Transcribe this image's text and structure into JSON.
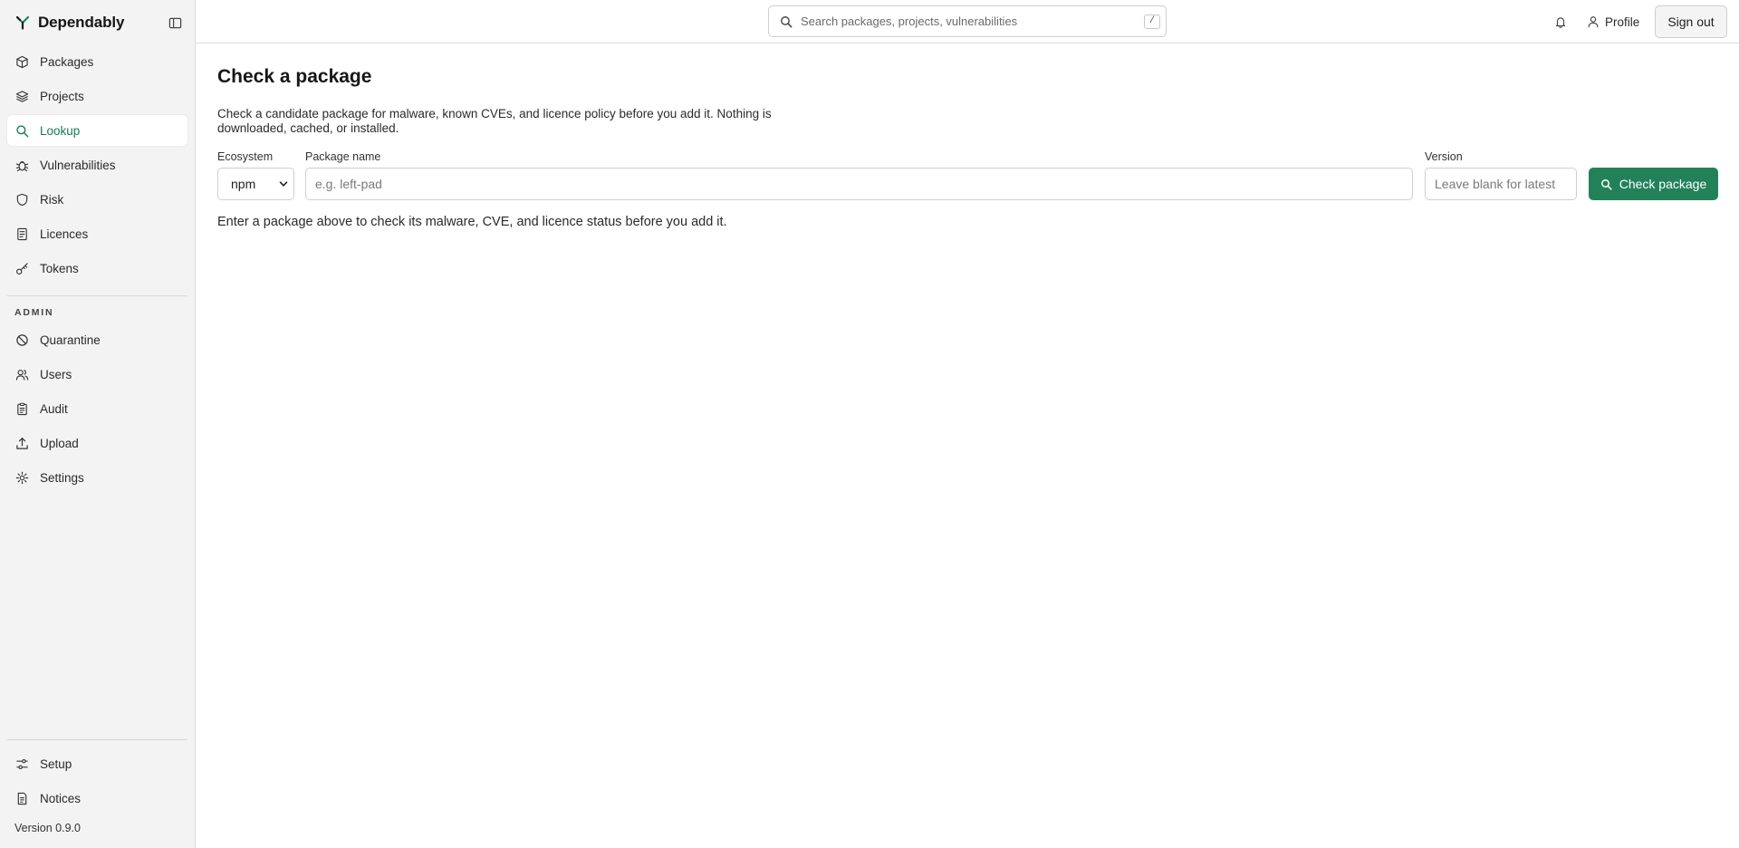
{
  "app": {
    "name": "Dependably",
    "version": "Version 0.9.0"
  },
  "colors": {
    "accent": "#23815a",
    "active_nav_text": "#1b7a52"
  },
  "sidebar": {
    "main_items": [
      {
        "label": "Packages",
        "icon": "package-icon",
        "active": false
      },
      {
        "label": "Projects",
        "icon": "layers-icon",
        "active": false
      },
      {
        "label": "Lookup",
        "icon": "search-icon",
        "active": true
      },
      {
        "label": "Vulnerabilities",
        "icon": "bug-icon",
        "active": false
      },
      {
        "label": "Risk",
        "icon": "shield-icon",
        "active": false
      },
      {
        "label": "Licences",
        "icon": "document-icon",
        "active": false
      },
      {
        "label": "Tokens",
        "icon": "key-icon",
        "active": false
      }
    ],
    "admin_label": "ADMIN",
    "admin_items": [
      {
        "label": "Quarantine",
        "icon": "ban-icon"
      },
      {
        "label": "Users",
        "icon": "users-icon"
      },
      {
        "label": "Audit",
        "icon": "clipboard-icon"
      },
      {
        "label": "Upload",
        "icon": "upload-icon"
      },
      {
        "label": "Settings",
        "icon": "gear-icon"
      }
    ],
    "bottom_items": [
      {
        "label": "Setup",
        "icon": "sliders-icon"
      },
      {
        "label": "Notices",
        "icon": "file-icon"
      }
    ]
  },
  "topbar": {
    "search_placeholder": "Search packages, projects, vulnerabilities",
    "search_shortcut": "/",
    "profile_label": "Profile",
    "signout_label": "Sign out"
  },
  "main": {
    "title": "Check a package",
    "description": "Check a candidate package for malware, known CVEs, and licence policy before you add it. Nothing is downloaded, cached, or installed.",
    "form": {
      "ecosystem_label": "Ecosystem",
      "ecosystem_value": "npm",
      "package_label": "Package name",
      "package_placeholder": "e.g. left-pad",
      "version_label": "Version",
      "version_placeholder": "Leave blank for latest",
      "submit_label": "Check package"
    },
    "hint": "Enter a package above to check its malware, CVE, and licence status before you add it."
  }
}
